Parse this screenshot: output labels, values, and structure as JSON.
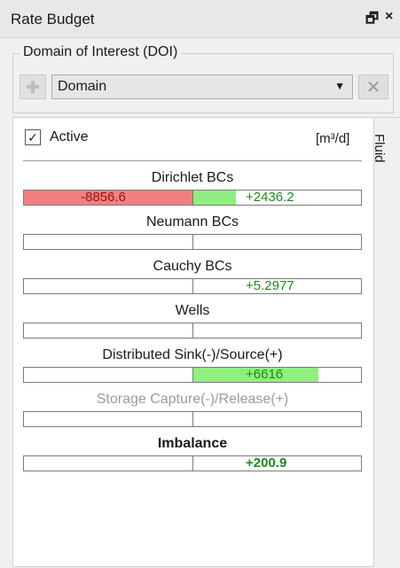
{
  "titlebar": {
    "title": "Rate Budget",
    "float_btn": "🗗",
    "close_btn": "×"
  },
  "doi": {
    "label": "Domain of Interest (DOI)",
    "domain_value": "Domain",
    "arrow": "▼",
    "clear": "✕"
  },
  "tab": {
    "label": "Fluid"
  },
  "panel": {
    "active_check": "✓",
    "active_label": "Active",
    "unit": "[m³/d]"
  },
  "rows": [
    {
      "label": "Dirichlet BCs",
      "neg": "-8856.6",
      "pos": "+2436.2",
      "neg_fill": 1.0,
      "pos_fill": 0.25
    },
    {
      "label": "Neumann BCs",
      "neg": "",
      "pos": "",
      "neg_fill": 0,
      "pos_fill": 0
    },
    {
      "label": "Cauchy BCs",
      "neg": "",
      "pos": "+5.2977",
      "neg_fill": 0,
      "pos_fill": 0
    },
    {
      "label": "Wells",
      "neg": "",
      "pos": "",
      "neg_fill": 0,
      "pos_fill": 0
    },
    {
      "label": "Distributed Sink(-)/Source(+)",
      "neg": "",
      "pos": "+6616",
      "neg_fill": 0,
      "pos_fill": 0.74
    },
    {
      "label": "Storage Capture(-)/Release(+)",
      "neg": "",
      "pos": "",
      "neg_fill": 0,
      "pos_fill": 0
    },
    {
      "label": "Imbalance",
      "neg": "",
      "pos": "+200.9",
      "neg_fill": 0,
      "pos_fill": 0
    }
  ],
  "colors": {
    "negative": "#f08080",
    "positive": "#90ee80"
  }
}
